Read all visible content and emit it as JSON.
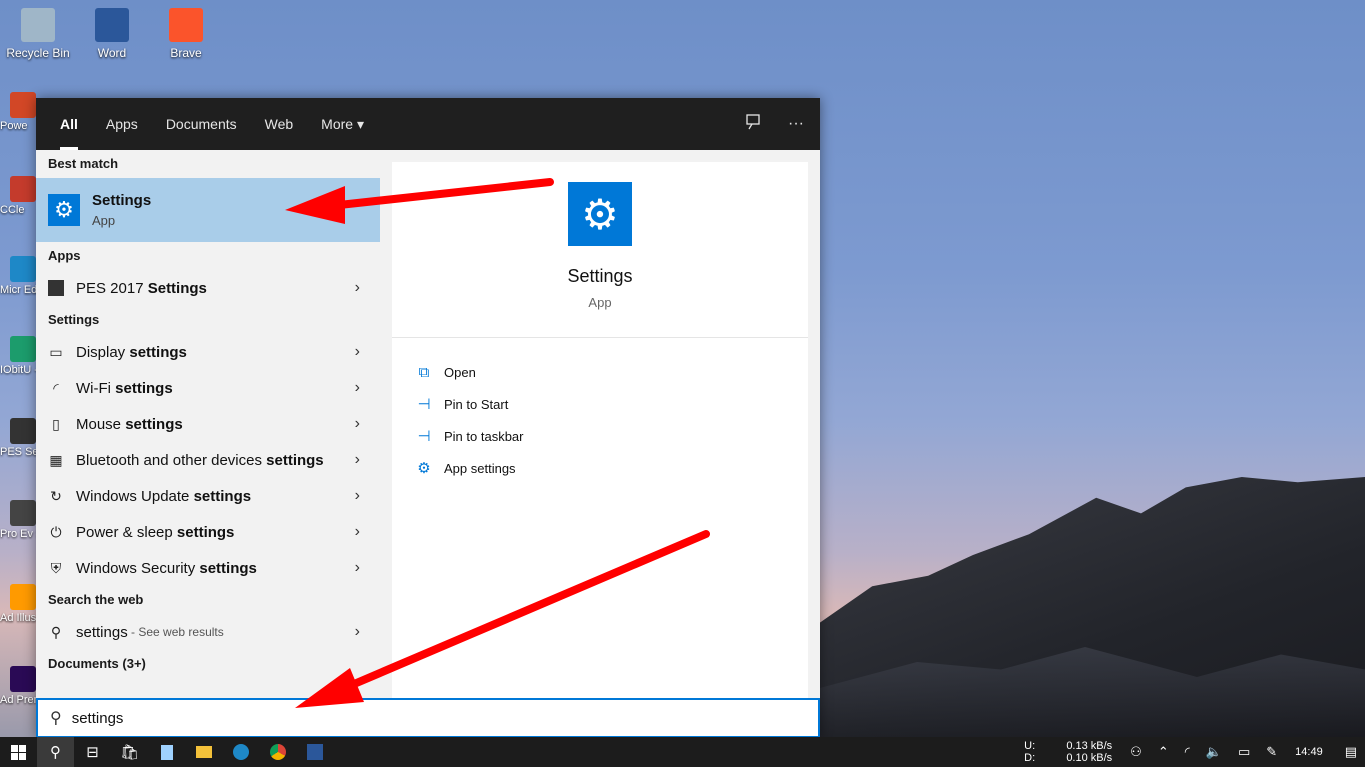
{
  "desktop": {
    "icons": [
      {
        "label": "Recycle Bin",
        "icon": "recycle-bin-icon",
        "color": "#9fb6c8"
      },
      {
        "label": "Word",
        "icon": "word-icon",
        "color": "#2b579a"
      },
      {
        "label": "Brave",
        "icon": "brave-icon",
        "color": "#fb542b"
      }
    ],
    "side_icons": [
      "Powe",
      "CCle",
      "Micr Ed",
      "IObitU - Sho",
      "PES Setti",
      "Pro Ev Socce",
      "Ad Illus",
      "Ad Premi"
    ]
  },
  "search": {
    "tabs": [
      "All",
      "Apps",
      "Documents",
      "Web",
      "More"
    ],
    "active_tab": "All",
    "more_caret": "▾",
    "feedback_icon": "feedback-icon",
    "options_icon": "···",
    "best_match_heading": "Best match",
    "best_match": {
      "name": "Settings",
      "type": "App"
    },
    "apps_heading": "Apps",
    "apps": [
      {
        "prefix": "PES 2017 ",
        "bold": "Settings"
      }
    ],
    "settings_heading": "Settings",
    "settings": [
      {
        "icon": "display-icon",
        "glyph": "▭",
        "prefix": "Display ",
        "bold": "settings"
      },
      {
        "icon": "wifi-icon",
        "glyph": "◜",
        "prefix": "Wi-Fi ",
        "bold": "settings"
      },
      {
        "icon": "mouse-icon",
        "glyph": "▯",
        "prefix": "Mouse ",
        "bold": "settings"
      },
      {
        "icon": "bluetooth-devices-icon",
        "glyph": "▦",
        "prefix": "Bluetooth and other devices ",
        "bold": "settings"
      },
      {
        "icon": "windows-update-icon",
        "glyph": "↻",
        "prefix": "Windows Update ",
        "bold": "settings"
      },
      {
        "icon": "power-icon",
        "glyph": "⏻",
        "prefix": "Power & sleep ",
        "bold": "settings"
      },
      {
        "icon": "shield-icon",
        "glyph": "⛨",
        "prefix": "Windows Security ",
        "bold": "settings"
      }
    ],
    "web_heading": "Search the web",
    "web_result": {
      "query": "settings",
      "suffix": " - See web results"
    },
    "documents_heading": "Documents (3+)",
    "detail": {
      "name": "Settings",
      "type": "App",
      "actions": [
        {
          "icon": "open-icon",
          "glyph": "⧉",
          "label": "Open"
        },
        {
          "icon": "pin-to-start-icon",
          "glyph": "⊣",
          "label": "Pin to Start"
        },
        {
          "icon": "pin-to-taskbar-icon",
          "glyph": "⊣",
          "label": "Pin to taskbar"
        },
        {
          "icon": "app-settings-icon",
          "glyph": "⚙",
          "label": "App settings"
        }
      ]
    },
    "query": "settings"
  },
  "taskbar": {
    "network": {
      "up_label": "U:",
      "up_value": "0.13 kB/s",
      "down_label": "D:",
      "down_value": "0.10 kB/s"
    },
    "clock": "14:49"
  },
  "colors": {
    "accent": "#0078d7",
    "highlight": "#a9cde9",
    "annotation": "#ff0000"
  }
}
